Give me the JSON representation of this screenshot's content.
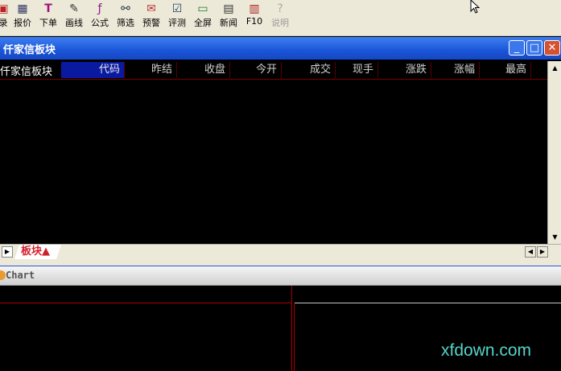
{
  "toolbar": {
    "items": [
      {
        "label": "录",
        "icon": "login-icon"
      },
      {
        "label": "报价",
        "icon": "quote-icon"
      },
      {
        "label": "下单",
        "icon": "order-icon"
      },
      {
        "label": "画线",
        "icon": "draw-icon"
      },
      {
        "label": "公式",
        "icon": "formula-icon"
      },
      {
        "label": "筛选",
        "icon": "filter-icon"
      },
      {
        "label": "预警",
        "icon": "alert-icon"
      },
      {
        "label": "评测",
        "icon": "test-icon"
      },
      {
        "label": "全屏",
        "icon": "fullscreen-icon"
      },
      {
        "label": "新闻",
        "icon": "news-icon"
      },
      {
        "label": "F10",
        "icon": "books-icon"
      },
      {
        "label": "说明",
        "icon": "help-icon"
      }
    ]
  },
  "window": {
    "title": "仟家信板块",
    "minimize": "_",
    "maximize": "□",
    "close": "✕"
  },
  "table": {
    "block_name": "仟家信板块",
    "columns": [
      "代码",
      "昨结",
      "收盘",
      "今开",
      "成交",
      "现手",
      "涨跌",
      "涨幅",
      "最高"
    ]
  },
  "tabs": {
    "active_label": "板块▲"
  },
  "chart_panel": {
    "title": "Chart"
  },
  "watermark": "xfdown.com",
  "colors": {
    "accent_red": "#d2202a",
    "title_blue": "#1b55d8",
    "grid_red": "#aa0000"
  }
}
